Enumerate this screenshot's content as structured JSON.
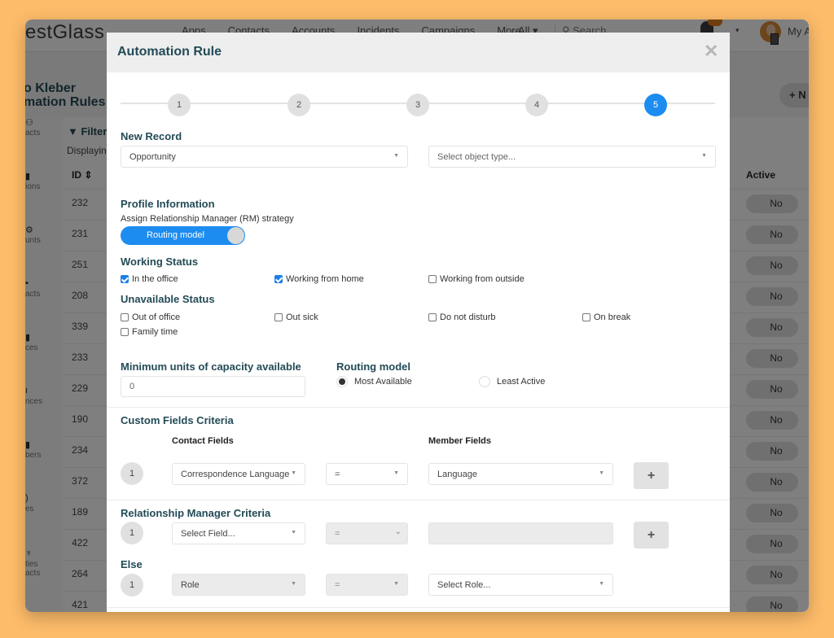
{
  "app": {
    "brand": "estGlass",
    "nav": [
      "Apps",
      "Contacts",
      "Accounts",
      "Incidents",
      "Campaigns",
      "More"
    ],
    "nav_filter": "All ▾",
    "search_placeholder": "Search",
    "account_label": "My A",
    "caret": "▾",
    "page_title_line1": "o Kleber",
    "page_title_line2": "mation Rules",
    "new_button": "+ N"
  },
  "sidebar": {
    "items": [
      {
        "glyph": "⚇",
        "label": "acts"
      },
      {
        "glyph": "▮",
        "label": "ions"
      },
      {
        "glyph": "⚙",
        "label": "unts"
      },
      {
        "glyph": "▪",
        "label": "acts"
      },
      {
        "glyph": "▮",
        "label": "ces"
      },
      {
        "glyph": "ı",
        "label": "nces"
      },
      {
        "glyph": "▮",
        "label": "bers"
      },
      {
        "glyph": ")",
        "label": "es"
      },
      {
        "glyph": "♆",
        "label": "ties"
      },
      {
        "glyph": "",
        "label": "acts"
      }
    ]
  },
  "list": {
    "filters_label": "▼ Filters",
    "displaying_label": "Displaying",
    "col_id": "ID ⇕",
    "col_active": "Active",
    "rows": [
      {
        "id": "232",
        "active": "No"
      },
      {
        "id": "231",
        "active": "No"
      },
      {
        "id": "251",
        "active": "No"
      },
      {
        "id": "208",
        "active": "No"
      },
      {
        "id": "339",
        "active": "No"
      },
      {
        "id": "233",
        "active": "No"
      },
      {
        "id": "229",
        "active": "No"
      },
      {
        "id": "190",
        "active": "No"
      },
      {
        "id": "234",
        "active": "No"
      },
      {
        "id": "372",
        "active": "No"
      },
      {
        "id": "189",
        "active": "No"
      },
      {
        "id": "422",
        "active": "No"
      },
      {
        "id": "264",
        "active": "No"
      },
      {
        "id": "421",
        "active": "No"
      }
    ]
  },
  "modal": {
    "title": "Automation Rule",
    "close_icon": "✕",
    "steps": [
      "1",
      "2",
      "3",
      "4",
      "5"
    ],
    "active_step": "5",
    "new_record": {
      "title": "New Record",
      "record_select": "Opportunity",
      "object_type_placeholder": "Select object type..."
    },
    "profile": {
      "title": "Profile Information",
      "strategy_label": "Assign Relationship Manager (RM) strategy",
      "toggle_label": "Routing model"
    },
    "working_status": {
      "title": "Working Status",
      "options": [
        {
          "label": "In the office",
          "checked": true
        },
        {
          "label": "Working from home",
          "checked": true
        },
        {
          "label": "Working from outside",
          "checked": false
        }
      ]
    },
    "unavailable_status": {
      "title": "Unavailable Status",
      "options": [
        {
          "label": "Out of office",
          "checked": false
        },
        {
          "label": "Out sick",
          "checked": false
        },
        {
          "label": "Do not disturb",
          "checked": false
        },
        {
          "label": "On break",
          "checked": false
        },
        {
          "label": "Family time",
          "checked": false
        }
      ]
    },
    "capacity": {
      "title": "Minimum units of capacity available",
      "value": "0"
    },
    "routing_model": {
      "title": "Routing model",
      "options": [
        {
          "label": "Most Available",
          "selected": true
        },
        {
          "label": "Least Active",
          "selected": false
        }
      ]
    },
    "custom_fields": {
      "title": "Custom Fields Criteria",
      "contact_fields_label": "Contact Fields",
      "member_fields_label": "Member Fields",
      "row_number": "1",
      "contact_field": "Correspondence Language",
      "operator": "=",
      "member_field": "Language",
      "add_icon": "+"
    },
    "rm_criteria": {
      "title": "Relationship Manager Criteria",
      "row_number": "1",
      "field_placeholder": "Select Field...",
      "operator": "=",
      "value": "",
      "add_icon": "+"
    },
    "else": {
      "title": "Else",
      "row_number": "1",
      "field": "Role",
      "operator": "=",
      "role_placeholder": "Select Role..."
    }
  }
}
